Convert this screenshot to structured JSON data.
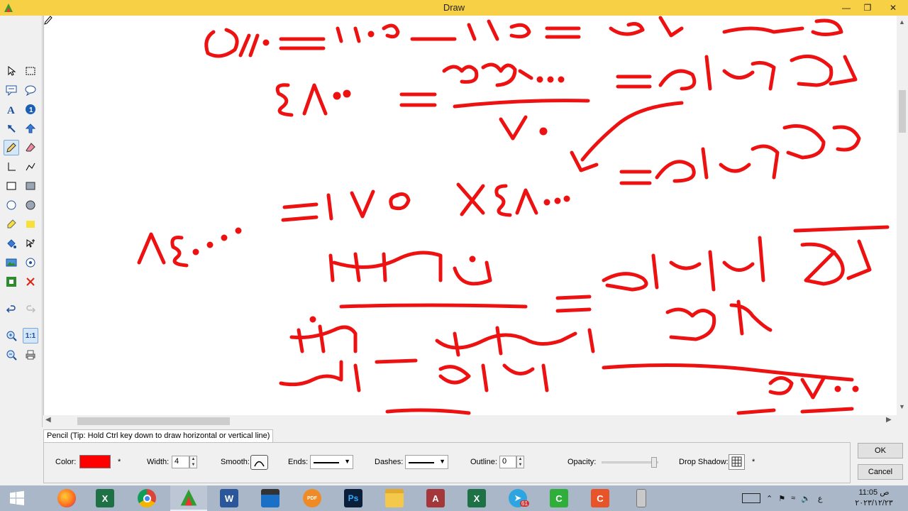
{
  "window": {
    "title": "Draw"
  },
  "toolbox": {
    "tools": [
      {
        "name": "select-icon"
      },
      {
        "name": "marquee-select-icon"
      },
      {
        "name": "callout-icon"
      },
      {
        "name": "callout-round-icon"
      },
      {
        "name": "text-icon"
      },
      {
        "name": "info-icon"
      },
      {
        "name": "arrow-icon"
      },
      {
        "name": "thick-arrow-icon"
      },
      {
        "name": "pencil-icon"
      },
      {
        "name": "eraser-icon"
      },
      {
        "name": "angle-line-icon"
      },
      {
        "name": "polyline-icon"
      },
      {
        "name": "rectangle-icon"
      },
      {
        "name": "filled-rectangle-icon"
      },
      {
        "name": "ellipse-icon"
      },
      {
        "name": "filled-ellipse-icon"
      },
      {
        "name": "highlighter-icon"
      },
      {
        "name": "highlight-box-icon"
      },
      {
        "name": "fill-icon"
      },
      {
        "name": "select-add-icon"
      },
      {
        "name": "image-icon"
      },
      {
        "name": "step-number-icon"
      },
      {
        "name": "color-picker-icon"
      },
      {
        "name": "delete-icon"
      },
      {
        "name": "undo-icon"
      },
      {
        "name": "redo-icon"
      },
      {
        "name": "zoom-in-icon"
      },
      {
        "name": "zoom-actual-icon"
      },
      {
        "name": "zoom-out-icon"
      },
      {
        "name": "print-icon"
      }
    ],
    "zoom_actual_label": "1:1"
  },
  "canvas": {
    "ink_color": "#ee1111"
  },
  "properties": {
    "tab_label": "Pencil (Tip: Hold Ctrl key down to draw horizontal or vertical line)",
    "color_label": "Color:",
    "color_value": "#ff0000",
    "asterisk": "*",
    "width_label": "Width:",
    "width_value": "4",
    "smooth_label": "Smooth:",
    "ends_label": "Ends:",
    "dashes_label": "Dashes:",
    "outline_label": "Outline:",
    "outline_value": "0",
    "opacity_label": "Opacity:",
    "opacity_value": 1.0,
    "drop_shadow_label": "Drop Shadow:",
    "ok_label": "OK",
    "cancel_label": "Cancel"
  },
  "taskbar": {
    "apps": [
      {
        "name": "windows-start-icon"
      },
      {
        "name": "firefox-icon"
      },
      {
        "name": "excel-icon"
      },
      {
        "name": "chrome-icon"
      },
      {
        "name": "draw-app-icon"
      },
      {
        "name": "word-icon"
      },
      {
        "name": "video-editor-icon"
      },
      {
        "name": "pdf-tool-icon",
        "label": "PDF"
      },
      {
        "name": "photoshop-icon",
        "label": "Ps"
      },
      {
        "name": "file-explorer-icon"
      },
      {
        "name": "access-icon"
      },
      {
        "name": "excel-2-icon"
      },
      {
        "name": "telegram-icon",
        "badge": "61"
      },
      {
        "name": "camtasia-green-icon"
      },
      {
        "name": "camtasia-orange-icon"
      },
      {
        "name": "phone-icon"
      }
    ],
    "tray": {
      "lang": "ع",
      "time": "11:05 ص",
      "date": "٢٠٢٣/١٢/٢٣"
    }
  }
}
